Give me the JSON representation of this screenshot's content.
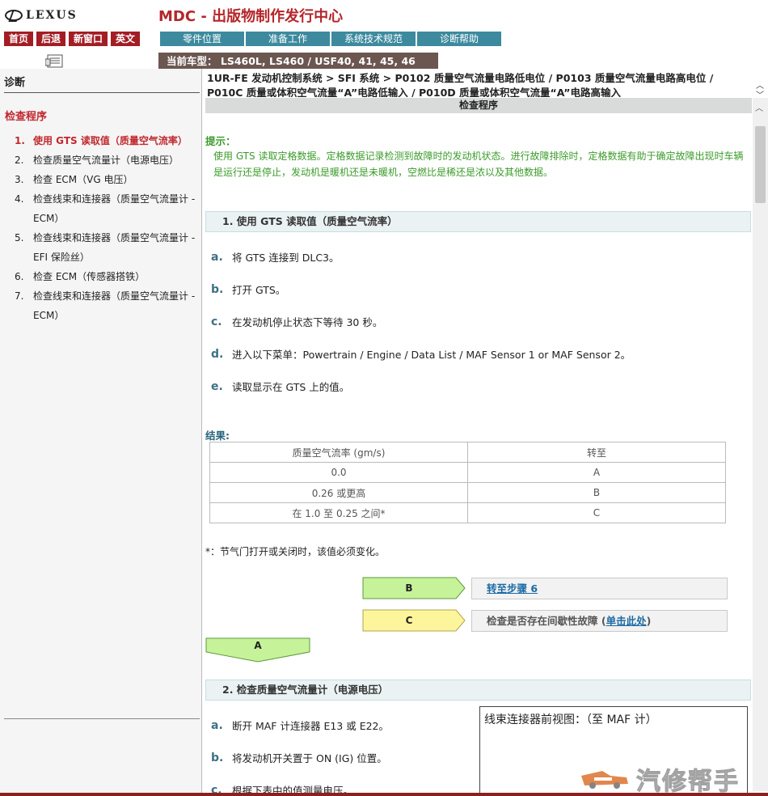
{
  "header": {
    "logo_text": "LEXUS",
    "site_title": "MDC - 出版物制作发行中心",
    "nav_buttons": [
      "首页",
      "后退",
      "新窗口",
      "英文"
    ],
    "tabs": [
      "零件位置",
      "准备工作",
      "系统技术规范",
      "诊断帮助"
    ],
    "vehicle": "当前车型：  LS460L, LS460 / USF40, 41, 45, 46"
  },
  "sidebar": {
    "heading": "诊断",
    "subheading": "检查程序",
    "items": [
      {
        "num": "1.",
        "label": "使用 GTS 读取值（质量空气流率）"
      },
      {
        "num": "2.",
        "label": "检查质量空气流量计（电源电压）"
      },
      {
        "num": "3.",
        "label": "检查 ECM（VG 电压）"
      },
      {
        "num": "4.",
        "label": "检查线束和连接器（质量空气流量计 - ECM）"
      },
      {
        "num": "5.",
        "label": "检查线束和连接器（质量空气流量计 - EFI 保险丝）"
      },
      {
        "num": "6.",
        "label": "检查 ECM（传感器搭铁）"
      },
      {
        "num": "7.",
        "label": "检查线束和连接器（质量空气流量计 - ECM）"
      }
    ]
  },
  "breadcrumb": "1UR-FE 发动机控制系统 > SFI 系统 > P0102 质量空气流量电路低电位 / P0103 质量空气流量电路高电位 / P010C 质量或体积空气流量“A”电路低输入 / P010D 质量或体积空气流量“A”电路高输入",
  "section_title": "检查程序",
  "hint": {
    "label": "提示：",
    "text": "使用 GTS 读取定格数据。定格数据记录检测到故障时的发动机状态。进行故障排除时，定格数据有助于确定故障出现时车辆是运行还是停止，发动机是暖机还是未暖机，空燃比是稀还是浓以及其他数据。"
  },
  "step1": {
    "title": "1. 使用 GTS 读取值（质量空气流率）",
    "substeps": [
      {
        "letter": "a.",
        "text": "将 GTS 连接到 DLC3。"
      },
      {
        "letter": "b.",
        "text": "打开 GTS。"
      },
      {
        "letter": "c.",
        "text": "在发动机停止状态下等待 30 秒。"
      },
      {
        "letter": "d.",
        "text": "进入以下菜单：Powertrain / Engine / Data List / MAF Sensor 1 or MAF Sensor 2。"
      },
      {
        "letter": "e.",
        "text": "读取显示在 GTS 上的值。"
      }
    ],
    "result_label": "结果:",
    "table": {
      "headers": [
        "质量空气流率 (gm/s)",
        "转至"
      ],
      "rows": [
        [
          "0.0",
          "A"
        ],
        [
          "0.26 或更高",
          "B"
        ],
        [
          "在 1.0 至 0.25 之间*",
          "C"
        ]
      ]
    },
    "note": "*：节气门打开或关闭时，该值必须变化。",
    "flow": {
      "b_label": "B",
      "b_link": "转至步骤 6",
      "c_label": "C",
      "c_text": "检查是否存在间歇性故障 (",
      "c_link": "单击此处",
      "c_end": ")",
      "a_label": "A"
    }
  },
  "step2": {
    "title": "2. 检查质量空气流量计（电源电压）",
    "substeps": [
      {
        "letter": "a.",
        "text": "断开 MAF 计连接器 E13 或 E22。"
      },
      {
        "letter": "b.",
        "text": "将发动机开关置于 ON (IG) 位置。"
      },
      {
        "letter": "c.",
        "text": "根据下表中的值测量电压。"
      }
    ],
    "diagram_title": "线束连接器前视图：（至 MAF 计）"
  },
  "watermark": "汽修帮手",
  "colors": {
    "brand_red": "#b5262a",
    "tab_teal": "#3d8a9e",
    "hint_green": "#3b9b2a",
    "arrow_green": "#c6f29a",
    "arrow_yellow": "#fdf59c"
  }
}
